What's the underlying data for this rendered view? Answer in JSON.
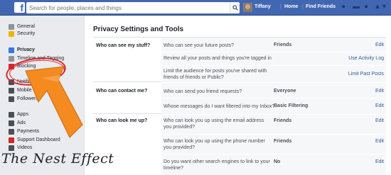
{
  "topbar": {
    "logo": "f",
    "search_placeholder": "Search for people, places and things",
    "user_name": "Tiffany",
    "home": "Home",
    "find_friends": "Find Friends"
  },
  "nav": {
    "items": [
      {
        "label": "General",
        "color": "#8d949e"
      },
      {
        "label": "Security",
        "color": "#f0b400"
      },
      {
        "label": "Privacy",
        "color": "#3578e5"
      },
      {
        "label": "Timeline and Tagging",
        "color": "#8d949e"
      },
      {
        "label": "Blocking",
        "color": "#d8242a"
      },
      {
        "label": "Notifications",
        "color": "#4b4f56"
      },
      {
        "label": "Mobile",
        "color": "#4b4f56"
      },
      {
        "label": "Followers",
        "color": "#4b4f56"
      },
      {
        "label": "Apps",
        "color": "#4b4f56"
      },
      {
        "label": "Ads",
        "color": "#4b4f56"
      },
      {
        "label": "Payments",
        "color": "#4b4f56"
      },
      {
        "label": "Support Dashboard",
        "color": "#d8242a"
      },
      {
        "label": "Videos",
        "color": "#4b4f56"
      }
    ]
  },
  "watermark": "The Nest Effect",
  "panel": {
    "title": "Privacy Settings and Tools",
    "sections": [
      {
        "label": "Who can see my stuff?",
        "rows": [
          {
            "q": "Who can see your future posts?",
            "val": "Friends",
            "edit": "Edit"
          },
          {
            "q": "Review all your posts and things you're tagged in",
            "val": "",
            "edit": "Use Activity Log"
          },
          {
            "q": "Limit the audience for posts you've shared with friends of friends or Public?",
            "val": "",
            "edit": "Limit Past Posts"
          }
        ]
      },
      {
        "label": "Who can contact me?",
        "rows": [
          {
            "q": "Who can send you friend requests?",
            "val": "Everyone",
            "edit": "Edit"
          },
          {
            "q": "Whose messages do I want filtered into my Inbox?",
            "val": "Basic Filtering",
            "edit": "Edit"
          }
        ]
      },
      {
        "label": "Who can look me up?",
        "rows": [
          {
            "q": "Who can look you up using the email address you provided?",
            "val": "Friends",
            "edit": "Edit"
          },
          {
            "q": "Who can look you up using the phone number you provided?",
            "val": "Friends",
            "edit": "Edit"
          },
          {
            "q": "Do you want other search engines to link to your timeline?",
            "val": "No",
            "edit": "Edit"
          }
        ]
      }
    ]
  },
  "colors": {
    "brand": "#4267b2",
    "link": "#365899",
    "annotation": "#d8242a",
    "arrow": "#f58a1f"
  }
}
